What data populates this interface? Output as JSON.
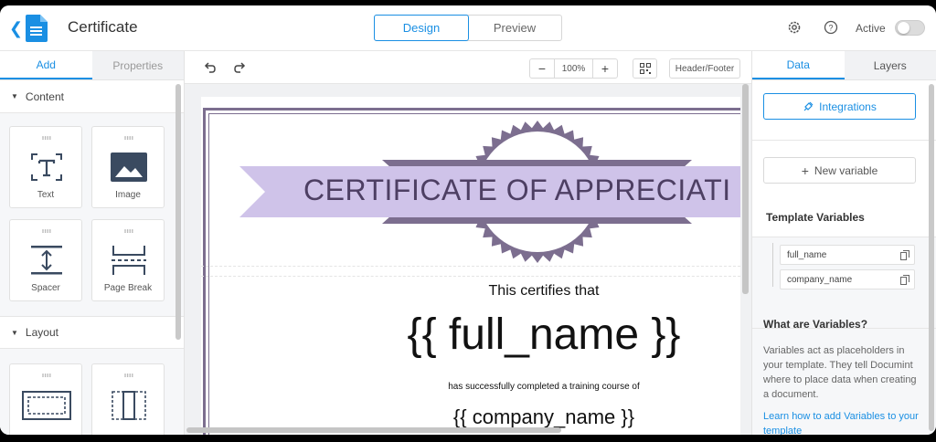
{
  "header": {
    "back_icon": "chevron-left-icon",
    "doc_icon": "document-icon",
    "title": "Certificate",
    "tabs": [
      {
        "label": "Design",
        "active": true
      },
      {
        "label": "Preview",
        "active": false
      }
    ],
    "settings_icon": "gear-icon",
    "help_icon": "help-icon",
    "active_label": "Active",
    "active_toggle_on": false,
    "accent_color": "#1a8fe3"
  },
  "left_panel": {
    "tabs": [
      {
        "label": "Add",
        "active": true
      },
      {
        "label": "Properties",
        "active": false
      }
    ],
    "content_section": "Content",
    "content_items": [
      {
        "label": "Text",
        "icon": "text-icon"
      },
      {
        "label": "Image",
        "icon": "image-icon"
      },
      {
        "label": "Spacer",
        "icon": "spacer-icon"
      },
      {
        "label": "Page Break",
        "icon": "page-break-icon"
      }
    ],
    "layout_section": "Layout",
    "layout_items": [
      {
        "icon": "layout-columns-icon"
      },
      {
        "icon": "layout-column-icon"
      }
    ]
  },
  "canvas_toolbar": {
    "undo_icon": "undo-icon",
    "redo_icon": "redo-icon",
    "zoom_out": "−",
    "zoom_value": "100%",
    "zoom_in": "+",
    "qr_icon": "qr-code-icon",
    "header_footer_label": "Header/Footer"
  },
  "certificate": {
    "title": "CERTIFICATE OF APPRECIATI",
    "line1": "This certifies that",
    "name_placeholder": "{{ full_name }}",
    "line2": "has successfully completed a training course of",
    "company_placeholder": "{{ company_name }}",
    "banner_color": "#cfc3e9",
    "dark_color": "#7c6e8f"
  },
  "right_panel": {
    "tabs": [
      {
        "label": "Data",
        "active": true
      },
      {
        "label": "Layers",
        "active": false
      }
    ],
    "integrations_label": "Integrations",
    "new_variable_label": "New variable",
    "template_variables_heading": "Template Variables",
    "variables": [
      "full_name",
      "company_name"
    ],
    "what_heading": "What are Variables?",
    "what_body": "Variables act as placeholders in your template. They tell Documint where to place data when creating a document.",
    "learn_link": "Learn how to add Variables to your template"
  }
}
